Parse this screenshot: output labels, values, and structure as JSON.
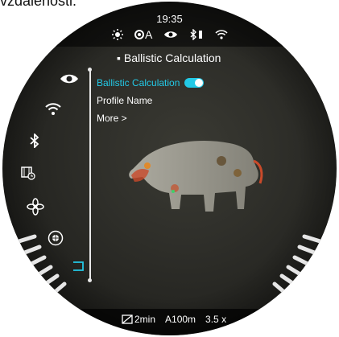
{
  "top_text": "vzdálenosti.",
  "status": {
    "time": "19:35",
    "icons": [
      "brightness-icon",
      "auto-calibration-icon",
      "eye-icon",
      "bluetooth-battery-icon",
      "wifi-icon"
    ],
    "calibration_label": "A"
  },
  "menu": {
    "title": "Ballistic Calculation",
    "items": [
      {
        "label": "Ballistic Calculation",
        "active": true
      },
      {
        "label": "Profile Name",
        "active": false
      },
      {
        "label": "More >",
        "active": false
      }
    ],
    "toggle_state": "on"
  },
  "sidebar": {
    "icons": [
      "eye-icon",
      "wifi-icon",
      "bluetooth-icon",
      "video-settings-icon",
      "fan-icon",
      "target-icon",
      "bracket-icon"
    ]
  },
  "bottom": {
    "timer": "2min",
    "range": "A100m",
    "zoom": "3.5 x"
  },
  "colors": {
    "accent": "#23c9e6",
    "background": "#2f2f2a"
  }
}
